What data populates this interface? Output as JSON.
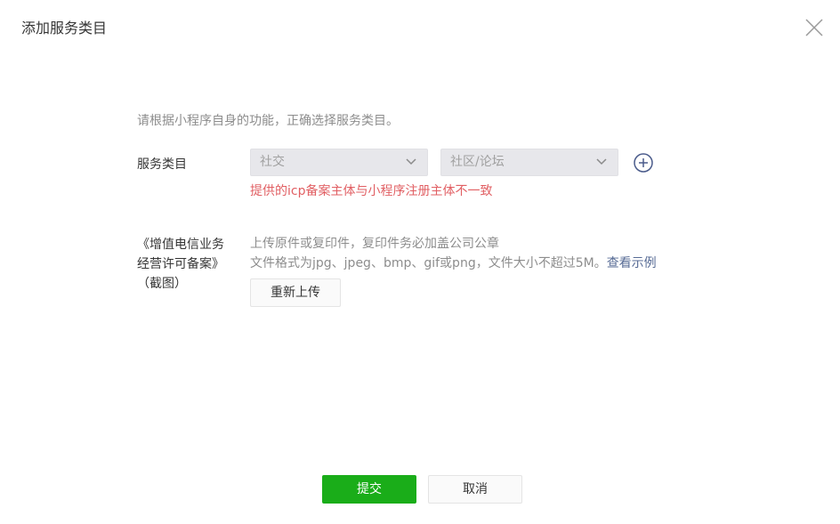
{
  "dialog": {
    "title": "添加服务类目",
    "close_icon": "close-icon"
  },
  "intro_text": "请根据小程序自身的功能，正确选择服务类目。",
  "category": {
    "label": "服务类目",
    "primary_select": "社交",
    "secondary_select": "社区/论坛",
    "add_icon": "plus-circle-icon",
    "error": "提供的icp备案主体与小程序注册主体不一致"
  },
  "license": {
    "label": "《增值电信业务经营许可备案》（截图）",
    "hint_line1": "上传原件或复印件，复印件务必加盖公司公章",
    "hint_line2": "文件格式为jpg、jpeg、bmp、gif或png，文件大小不超过5M。",
    "example_link": "查看示例",
    "reupload_button": "重新上传"
  },
  "footer": {
    "submit_button": "提交",
    "cancel_button": "取消"
  },
  "colors": {
    "primary": "#1aad19",
    "error": "#e15f63",
    "link": "#576b95"
  }
}
